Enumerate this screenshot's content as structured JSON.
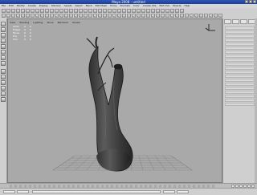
{
  "window": {
    "title": "Maya 2008 - untitled"
  },
  "menubar": {
    "items": [
      "File",
      "Edit",
      "Modify",
      "Create",
      "Display",
      "Window",
      "Assets",
      "Select",
      "Mesh",
      "Edit Mesh",
      "Proxy",
      "Normals",
      "Color",
      "Create UVs",
      "Edit UVs",
      "Muscle",
      "Help"
    ]
  },
  "viewport": {
    "panel_menu": [
      "View",
      "Shading",
      "Lighting",
      "Show",
      "Renderer",
      "Panels"
    ],
    "hud": [
      {
        "label": "Verts",
        "a": "0",
        "b": "0"
      },
      {
        "label": "Edges",
        "a": "0",
        "b": "0"
      },
      {
        "label": "Faces",
        "a": "0",
        "b": "0"
      },
      {
        "label": "Tris",
        "a": "0",
        "b": "0"
      },
      {
        "label": "UVs",
        "a": "0",
        "b": "0"
      }
    ],
    "scene": {
      "object": "tree-trunk",
      "grid": true,
      "background": "#a9a9a9",
      "mesh_color": "#444444"
    }
  },
  "toolbar": {
    "row1_icons": 38,
    "row2_icons": 46
  },
  "rightpanel": {
    "tabs": 4,
    "rows": 20
  },
  "timeline": {
    "track_visible": true
  }
}
